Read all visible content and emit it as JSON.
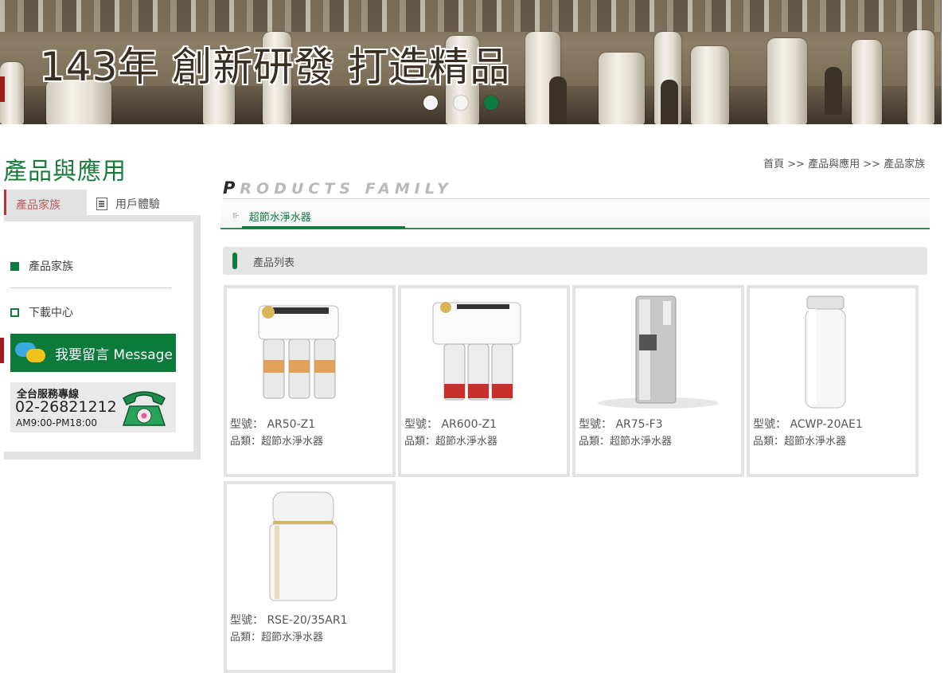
{
  "banner": {
    "headline": "143年 創新研發  打造精品",
    "slides": 3,
    "active_slide": 3
  },
  "sidebar": {
    "section_title": "產品與應用",
    "tabs": [
      {
        "label": "產品家族",
        "active": true
      },
      {
        "label": "用戶體驗",
        "active": false
      }
    ],
    "items": [
      {
        "label": "產品家族"
      },
      {
        "label": "下載中心"
      }
    ],
    "message_button": "我要留言 Message",
    "hotline": {
      "label": "全台服務專線",
      "phone": "02-26821212",
      "hours": "AM9:00-PM18:00"
    }
  },
  "breadcrumb": {
    "home": "首頁",
    "sep": ">>",
    "level1": "產品與應用",
    "level2": "產品家族"
  },
  "heading": {
    "first_letter": "P",
    "rest": "RODUCTS FAMILY"
  },
  "category_tab": "超節水淨水器",
  "list_header": "產品列表",
  "products": [
    {
      "model": "型號： AR50-Z1",
      "category": "品類：超節水淨水器",
      "icon": "ro-filter-unit"
    },
    {
      "model": "型號： AR600-Z1",
      "category": "品類：超節水淨水器",
      "icon": "ro-filter-unit"
    },
    {
      "model": "型號： AR75-F3",
      "category": "品類：超節水淨水器",
      "icon": "water-dispenser"
    },
    {
      "model": "型號： ACWP-20AE1",
      "category": "品類：超節水淨水器",
      "icon": "softener-tank"
    },
    {
      "model": "型號： RSE-20/35AR1",
      "category": "品類：超節水淨水器",
      "icon": "softener-cabinet"
    }
  ],
  "colors": {
    "brand_green": "#0d7a3e",
    "accent_red": "#a01d1d",
    "panel_gray": "#e2e2e2"
  }
}
